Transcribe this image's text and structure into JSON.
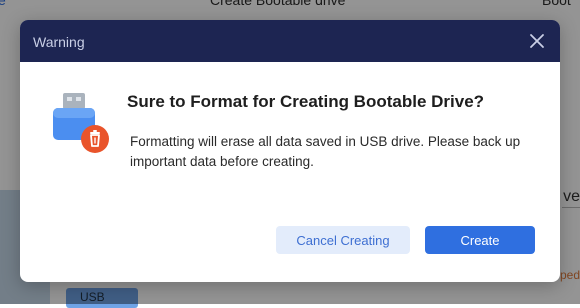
{
  "background": {
    "tabs": [
      "e",
      "Create Bootable drive",
      "Boot"
    ],
    "right_text": "ve",
    "right_link": "ped",
    "usb_label": "USB"
  },
  "dialog": {
    "title": "Warning",
    "heading": "Sure to Format for Creating Bootable Drive?",
    "message": "Formatting will erase all data saved in USB drive. Please back up important data before creating.",
    "cancel_label": "Cancel Creating",
    "create_label": "Create",
    "icons": {
      "close": "close-icon",
      "usb_format": "usb-drive-trash-icon"
    }
  },
  "colors": {
    "header_bg": "#1d2552",
    "primary": "#2f6fe0",
    "secondary_bg": "#e3ecfb",
    "danger": "#e9542b"
  }
}
